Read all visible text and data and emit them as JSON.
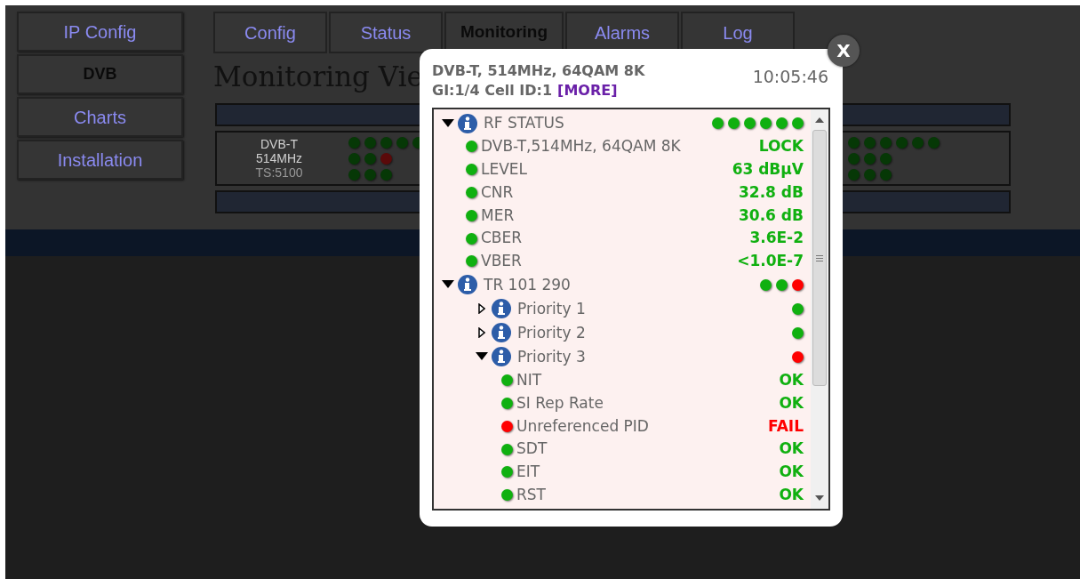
{
  "sidebar": {
    "items": [
      {
        "label": "IP Config",
        "selected": false
      },
      {
        "label": "DVB",
        "selected": true
      },
      {
        "label": "Charts",
        "selected": false
      },
      {
        "label": "Installation",
        "selected": false
      }
    ]
  },
  "tabs": [
    {
      "label": "Config",
      "selected": false
    },
    {
      "label": "Status",
      "selected": false
    },
    {
      "label": "Monitoring",
      "selected": true
    },
    {
      "label": "Alarms",
      "selected": false
    },
    {
      "label": "Log",
      "selected": false
    }
  ],
  "page_title": "Monitoring Vie",
  "channels": [
    {
      "lines": [
        "DVB-T",
        "514MHz",
        "TS:5100"
      ],
      "dot_rows": [
        [
          {
            "color": "#063806"
          },
          {
            "color": "#063806"
          },
          {
            "color": "#063806"
          },
          {
            "color": "#063806"
          },
          {
            "color": "#063806"
          }
        ],
        [
          {
            "color": "#063806"
          },
          {
            "color": "#063806"
          },
          {
            "color": "#5a0a0a"
          }
        ],
        [
          {
            "color": "#063806"
          },
          {
            "color": "#063806"
          },
          {
            "color": "#063806"
          }
        ]
      ]
    },
    {
      "dot_rows": [
        [
          {
            "color": "#063806"
          },
          {
            "color": "#063806"
          },
          {
            "color": "#063806"
          },
          {
            "color": "#063806"
          },
          {
            "color": "#063806"
          },
          {
            "color": "#063806"
          }
        ],
        [
          {
            "color": "#063806"
          },
          {
            "color": "#063806"
          },
          {
            "color": "#063806"
          }
        ],
        [
          {
            "color": "#063806"
          },
          {
            "color": "#063806"
          },
          {
            "color": "#063806"
          }
        ]
      ]
    }
  ],
  "dialog": {
    "close": "X",
    "header_line1": "DVB-T, 514MHz, 64QAM 8K",
    "header_line2": "GI:1/4 Cell ID:1",
    "more_link": "[MORE]",
    "time": "10:05:46",
    "tree": [
      {
        "kind": "group",
        "label": "RF STATUS",
        "expanded": true,
        "dots": [
          {
            "color": "#10b010"
          },
          {
            "color": "#10b010"
          },
          {
            "color": "#10b010"
          },
          {
            "color": "#10b010"
          },
          {
            "color": "#10b010"
          },
          {
            "color": "#10b010"
          }
        ],
        "children": [
          {
            "kind": "item",
            "label": "DVB-T,514MHz, 64QAM 8K",
            "color": "#10b010",
            "value": "LOCK"
          },
          {
            "kind": "item",
            "label": "LEVEL",
            "color": "#10b010",
            "value": "63 dBμV"
          },
          {
            "kind": "item",
            "label": "CNR",
            "color": "#10b010",
            "value": "32.8 dB"
          },
          {
            "kind": "item",
            "label": "MER",
            "color": "#10b010",
            "value": "30.6 dB"
          },
          {
            "kind": "item",
            "label": "CBER",
            "color": "#10b010",
            "value": "3.6E-2"
          },
          {
            "kind": "item",
            "label": "VBER",
            "color": "#10b010",
            "value": "<1.0E-7"
          }
        ]
      },
      {
        "kind": "group",
        "label": "TR 101 290",
        "expanded": true,
        "dots": [
          {
            "color": "#10b010"
          },
          {
            "color": "#10b010"
          },
          {
            "color": "#ff0000"
          }
        ],
        "children": [
          {
            "kind": "group",
            "label": "Priority 1",
            "expanded": false,
            "dots": [
              {
                "color": "#10b010"
              }
            ]
          },
          {
            "kind": "group",
            "label": "Priority 2",
            "expanded": false,
            "dots": [
              {
                "color": "#10b010"
              }
            ]
          },
          {
            "kind": "group",
            "label": "Priority 3",
            "expanded": true,
            "dots": [
              {
                "color": "#ff0000"
              }
            ],
            "children": [
              {
                "kind": "item",
                "label": "NIT",
                "color": "#10b010",
                "value": "OK"
              },
              {
                "kind": "item",
                "label": "SI Rep Rate",
                "color": "#10b010",
                "value": "OK"
              },
              {
                "kind": "item",
                "label": "Unreferenced PID",
                "color": "#ff0000",
                "value": "FAIL"
              },
              {
                "kind": "item",
                "label": "SDT",
                "color": "#10b010",
                "value": "OK"
              },
              {
                "kind": "item",
                "label": "EIT",
                "color": "#10b010",
                "value": "OK"
              },
              {
                "kind": "item",
                "label": "RST",
                "color": "#10b010",
                "value": "OK"
              }
            ]
          }
        ]
      }
    ]
  }
}
